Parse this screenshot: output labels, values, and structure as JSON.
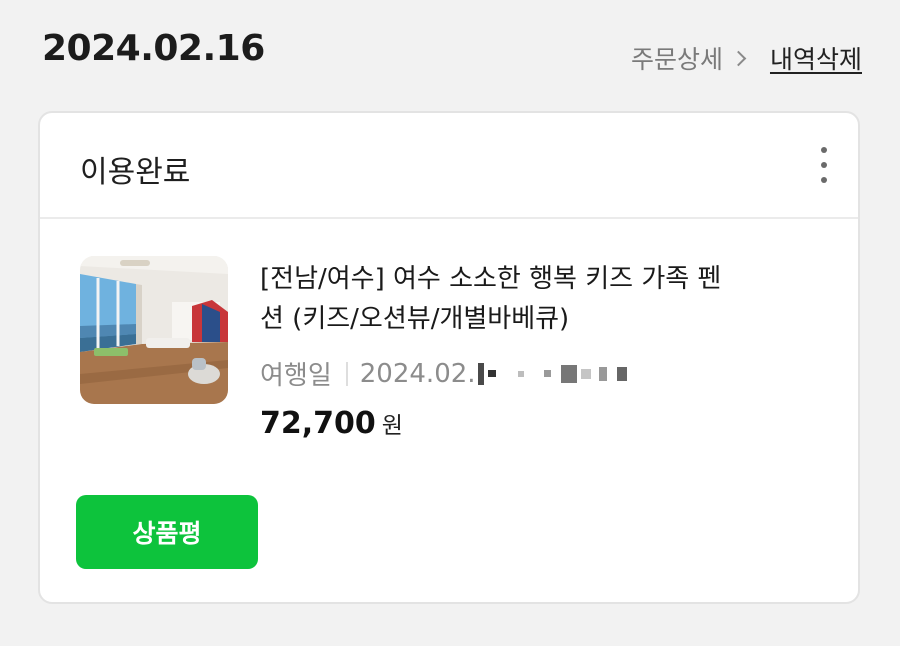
{
  "header": {
    "order_date": "2024.02.16",
    "order_detail_label": "주문상세",
    "delete_label": "내역삭제"
  },
  "card": {
    "status": "이용완료",
    "more_icon": "more-vertical-icon",
    "product": {
      "title": "[전남/여수] 여수 소소한 행복 키즈 가족 펜션 (키즈/오션뷰/개별바베큐)",
      "travel_label": "여행일",
      "travel_date_visible": "2024.02.",
      "price_amount": "72,700",
      "price_unit": "원"
    },
    "review_button_label": "상품평"
  },
  "colors": {
    "background": "#f2f2f2",
    "card": "#ffffff",
    "accent_green": "#0dc33c"
  }
}
